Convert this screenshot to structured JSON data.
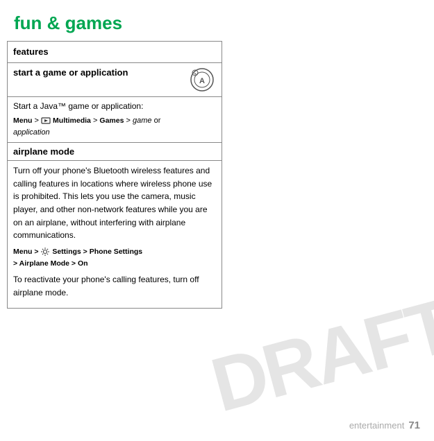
{
  "page": {
    "title": "fun & games",
    "footer_label": "entertainment",
    "footer_number": "71"
  },
  "table": {
    "header": "features",
    "section1": {
      "title": "start a game or application",
      "body": "Start a Java™ game or application:",
      "menu_path": "Menu > Multimedia > Games > game or application"
    },
    "section2": {
      "title": "airplane mode",
      "body": "Turn off your phone's Bluetooth wireless features and calling features in locations where wireless phone use is prohibited. This lets you use the camera, music player, and other non-network features while you are on an airplane, without interfering with airplane communications.",
      "menu_path_line1": "Menu >  Settings > Phone Settings",
      "menu_path_line2": "> Airplane Mode > On",
      "reactivate": "To reactivate your phone's calling features, turn off airplane mode."
    }
  },
  "watermark": "DRAFT"
}
